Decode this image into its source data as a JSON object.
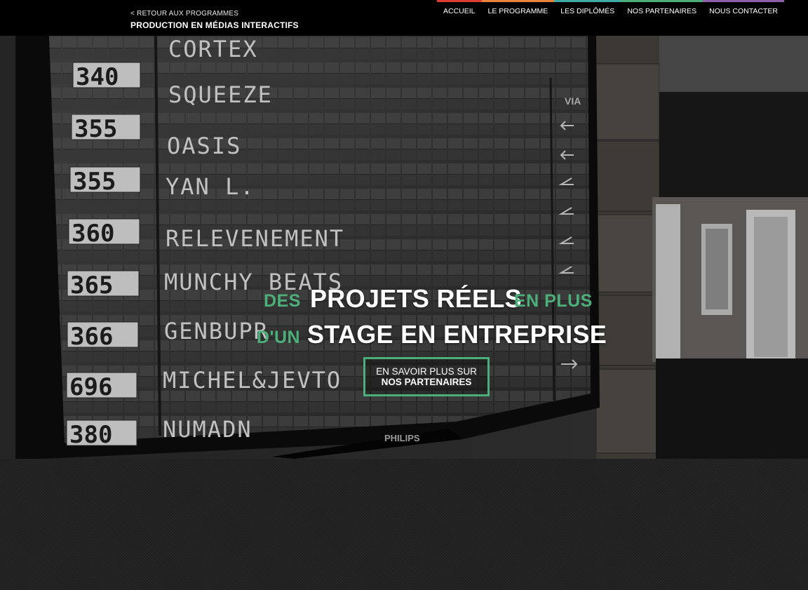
{
  "header": {
    "back_link": "< RETOUR AUX PROGRAMMES",
    "title": "PRODUCTION EN MÉDIAS INTERACTIFS"
  },
  "nav": {
    "items": [
      {
        "label": "ACCUEIL",
        "color": "#e03c31"
      },
      {
        "label": "LE PROGRAMME",
        "color": "#e8833a"
      },
      {
        "label": "LES DIPLÔMÉS",
        "color": "#3fa9a4"
      },
      {
        "label": "NOS PARTENAIRES",
        "color": "#4caf7a"
      },
      {
        "label": "NOUS CONTACTER",
        "color": "#8e5fa8"
      }
    ]
  },
  "hero": {
    "line1_pre": "DES",
    "line1_main": "PROJETS RÉELS",
    "line1_post": "EN PLUS",
    "line2_pre": "D'UN",
    "line2_main": "STAGE EN ENTREPRISE",
    "cta_line1": "EN SAVOIR PLUS SUR",
    "cta_line2": "NOS PARTENAIRES",
    "accent_color": "#4caf7a"
  },
  "board": {
    "brand": "PHILIPS",
    "via_label": "VIA",
    "rows": [
      {
        "num": "",
        "name": "CORTEX"
      },
      {
        "num": "340",
        "name": "SQUEEZE"
      },
      {
        "num": "355",
        "name": "OASIS"
      },
      {
        "num": "355",
        "name": "YAN L."
      },
      {
        "num": "360",
        "name": "RELEVENEMENT"
      },
      {
        "num": "365",
        "name": "MUNCHY BEATS"
      },
      {
        "num": "366",
        "name": "GENBUPR"
      },
      {
        "num": "696",
        "name": "MICHEL&JEVTO"
      },
      {
        "num": "380",
        "name": "NUMADN"
      }
    ]
  }
}
